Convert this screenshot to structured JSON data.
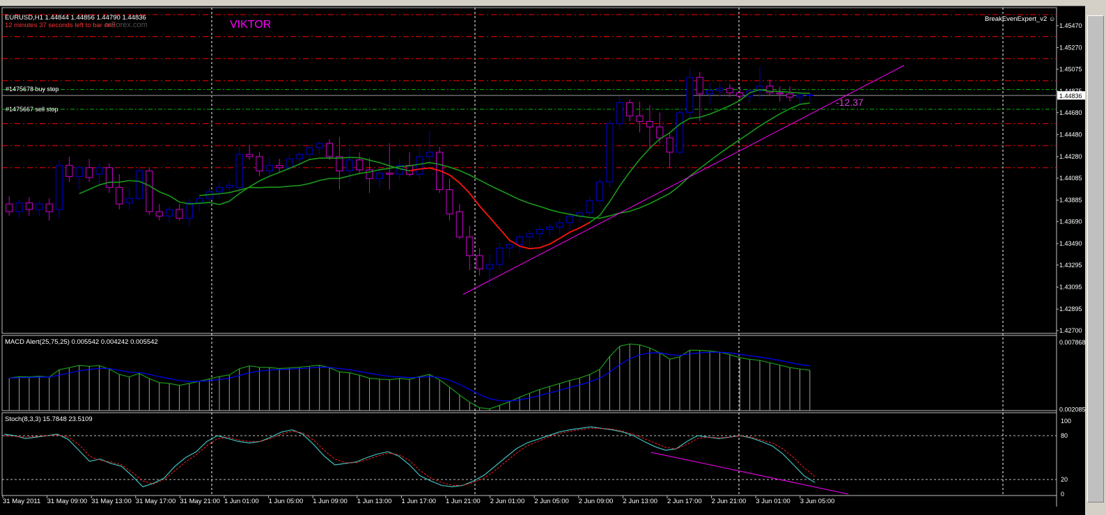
{
  "window": {
    "symbol_line": "EURUSD,H1  1.44844 1.44856 1.44790 1.44836",
    "countdown": "12 minutes 37 seconds left to bar end",
    "watermark": "orForex.com",
    "author": "VIKTOR",
    "expert": "BreakEvenExpert_v2",
    "order_buy": "#1475678 buy stop",
    "order_sell": "#1475667 sell stop",
    "pips_label": "-12.37",
    "current_price": "1.44836"
  },
  "colors": {
    "background": "#000000",
    "grid": "#c0c0c0",
    "bull": "#0000cc",
    "bear": "#cc00cc",
    "ma_fast": "#1b9a1b",
    "ma_turn": "#ff1010",
    "level": "#ff0000",
    "order_level": "#00c000",
    "trendline": "#ff00ff",
    "macd_signal": "#0000ff",
    "stoch_main": "#40c0c0",
    "stoch_signal": "#ff2020"
  },
  "chart_data": [
    {
      "type": "candlestick",
      "title": "EURUSD,H1",
      "x_labels": [
        "31 May 2011",
        "31 May 09:00",
        "31 May 13:00",
        "31 May 17:00",
        "31 May 21:00",
        "1 Jun 01:00",
        "1 Jun 05:00",
        "1 Jun 09:00",
        "1 Jun 13:00",
        "1 Jun 17:00",
        "1 Jun 21:00",
        "2 Jun 01:00",
        "2 Jun 05:00",
        "2 Jun 09:00",
        "2 Jun 13:00",
        "2 Jun 17:00",
        "2 Jun 21:00",
        "3 Jun 01:00",
        "3 Jun 05:00"
      ],
      "y_ticks": [
        "1.45470",
        "1.45270",
        "1.45075",
        "1.44875",
        "1.44680",
        "1.44480",
        "1.44280",
        "1.44085",
        "1.43885",
        "1.43690",
        "1.43490",
        "1.43295",
        "1.43095",
        "1.42895",
        "1.42700"
      ],
      "ylim": [
        1.427,
        1.4557
      ],
      "order_levels": [
        1.4489,
        1.4471
      ],
      "support_resistance": [
        1.4557,
        1.4537,
        1.4517,
        1.4497,
        1.4458,
        1.4438,
        1.4418
      ],
      "ohlc": [
        [
          1.4385,
          1.4392,
          1.4374,
          1.4378
        ],
        [
          1.4378,
          1.4389,
          1.4372,
          1.4386
        ],
        [
          1.4386,
          1.4391,
          1.4374,
          1.438
        ],
        [
          1.438,
          1.4388,
          1.4374,
          1.4385
        ],
        [
          1.4385,
          1.439,
          1.437,
          1.4378
        ],
        [
          1.438,
          1.4425,
          1.4372,
          1.442
        ],
        [
          1.442,
          1.4428,
          1.4405,
          1.441
        ],
        [
          1.441,
          1.442,
          1.4398,
          1.4418
        ],
        [
          1.4418,
          1.4426,
          1.4405,
          1.4409
        ],
        [
          1.4412,
          1.4422,
          1.4402,
          1.4418
        ],
        [
          1.4418,
          1.4422,
          1.4395,
          1.44
        ],
        [
          1.44,
          1.4412,
          1.438,
          1.4385
        ],
        [
          1.4386,
          1.44,
          1.438,
          1.439
        ],
        [
          1.439,
          1.4418,
          1.4388,
          1.4415
        ],
        [
          1.4415,
          1.4418,
          1.4375,
          1.4378
        ],
        [
          1.4378,
          1.4385,
          1.437,
          1.4374
        ],
        [
          1.4374,
          1.4383,
          1.4368,
          1.438
        ],
        [
          1.438,
          1.4385,
          1.437,
          1.4372
        ],
        [
          1.4372,
          1.439,
          1.4365,
          1.4386
        ],
        [
          1.4386,
          1.4392,
          1.4378,
          1.439
        ],
        [
          1.439,
          1.44,
          1.4384,
          1.4396
        ],
        [
          1.4396,
          1.4405,
          1.439,
          1.44
        ],
        [
          1.44,
          1.4406,
          1.4392,
          1.4402
        ],
        [
          1.44,
          1.4436,
          1.4395,
          1.443
        ],
        [
          1.443,
          1.4438,
          1.4425,
          1.4428
        ],
        [
          1.4428,
          1.4432,
          1.441,
          1.4415
        ],
        [
          1.4415,
          1.4428,
          1.441,
          1.442
        ],
        [
          1.442,
          1.4426,
          1.4414,
          1.4418
        ],
        [
          1.4418,
          1.443,
          1.4415,
          1.4426
        ],
        [
          1.4426,
          1.4432,
          1.442,
          1.443
        ],
        [
          1.443,
          1.444,
          1.4426,
          1.4436
        ],
        [
          1.4436,
          1.4442,
          1.443,
          1.444
        ],
        [
          1.444,
          1.4444,
          1.4425,
          1.4428
        ],
        [
          1.4428,
          1.4446,
          1.4398,
          1.4415
        ],
        [
          1.4415,
          1.4436,
          1.4405,
          1.4425
        ],
        [
          1.4425,
          1.4432,
          1.4412,
          1.4416
        ],
        [
          1.4416,
          1.4427,
          1.4395,
          1.4408
        ],
        [
          1.4408,
          1.442,
          1.44,
          1.4413
        ],
        [
          1.4413,
          1.444,
          1.4398,
          1.4412
        ],
        [
          1.4412,
          1.4426,
          1.4406,
          1.442
        ],
        [
          1.442,
          1.4432,
          1.441,
          1.4412
        ],
        [
          1.4412,
          1.444,
          1.4407,
          1.4428
        ],
        [
          1.4428,
          1.4452,
          1.442,
          1.4432
        ],
        [
          1.4432,
          1.4437,
          1.4395,
          1.4398
        ],
        [
          1.4398,
          1.4408,
          1.437,
          1.4376
        ],
        [
          1.4378,
          1.4385,
          1.4353,
          1.4355
        ],
        [
          1.4355,
          1.4365,
          1.4325,
          1.4338
        ],
        [
          1.4338,
          1.4345,
          1.432,
          1.4326
        ],
        [
          1.4326,
          1.434,
          1.431,
          1.433
        ],
        [
          1.433,
          1.435,
          1.4325,
          1.4345
        ],
        [
          1.4345,
          1.4352,
          1.4336,
          1.4348
        ],
        [
          1.4348,
          1.4358,
          1.434,
          1.4355
        ],
        [
          1.4355,
          1.4362,
          1.4346,
          1.4358
        ],
        [
          1.4358,
          1.4366,
          1.435,
          1.4362
        ],
        [
          1.4362,
          1.4367,
          1.4355,
          1.4364
        ],
        [
          1.4364,
          1.4372,
          1.4357,
          1.4368
        ],
        [
          1.4368,
          1.4378,
          1.4362,
          1.4374
        ],
        [
          1.4374,
          1.438,
          1.4368,
          1.4377
        ],
        [
          1.4377,
          1.4392,
          1.4372,
          1.4388
        ],
        [
          1.4388,
          1.4408,
          1.4384,
          1.4405
        ],
        [
          1.4405,
          1.4462,
          1.44,
          1.4458
        ],
        [
          1.4458,
          1.4483,
          1.4452,
          1.4477
        ],
        [
          1.4477,
          1.448,
          1.446,
          1.4465
        ],
        [
          1.4465,
          1.4478,
          1.445,
          1.446
        ],
        [
          1.446,
          1.4475,
          1.4435,
          1.4455
        ],
        [
          1.4455,
          1.4468,
          1.444,
          1.4445
        ],
        [
          1.4445,
          1.445,
          1.4418,
          1.4432
        ],
        [
          1.4432,
          1.4472,
          1.443,
          1.4468
        ],
        [
          1.4468,
          1.4508,
          1.4462,
          1.45
        ],
        [
          1.45,
          1.4505,
          1.446,
          1.4485
        ],
        [
          1.4485,
          1.4495,
          1.4475,
          1.4488
        ],
        [
          1.4488,
          1.4496,
          1.4482,
          1.449
        ],
        [
          1.449,
          1.4494,
          1.4482,
          1.4486
        ],
        [
          1.4486,
          1.4492,
          1.448,
          1.4483
        ],
        [
          1.4483,
          1.449,
          1.4477,
          1.4488
        ],
        [
          1.4488,
          1.451,
          1.448,
          1.4492
        ],
        [
          1.4492,
          1.4498,
          1.4484,
          1.4486
        ],
        [
          1.4486,
          1.4492,
          1.4478,
          1.4485
        ],
        [
          1.4485,
          1.4492,
          1.4478,
          1.4482
        ],
        [
          1.4482,
          1.4487,
          1.4476,
          1.4484
        ],
        [
          1.4484,
          1.4486,
          1.4478,
          1.4484
        ]
      ]
    },
    {
      "type": "bar",
      "title": "MACD Alert(25,75,25) 0.005542 0.004242 0.005542",
      "y_ticks": [
        "0.007868",
        "0.002085"
      ],
      "ylim": [
        0.002,
        0.008
      ]
    },
    {
      "type": "line",
      "title": "Stoch(8,3,3) 15.7848 23.5109",
      "y_ticks": [
        "100",
        "80",
        "20",
        "0"
      ],
      "ylim": [
        0,
        100
      ],
      "levels": [
        80,
        20
      ],
      "main": [
        82,
        80,
        76,
        78,
        80,
        82,
        75,
        60,
        45,
        48,
        42,
        38,
        25,
        10,
        15,
        22,
        38,
        50,
        58,
        72,
        80,
        76,
        72,
        70,
        72,
        78,
        85,
        88,
        82,
        68,
        52,
        40,
        42,
        44,
        50,
        55,
        58,
        52,
        40,
        25,
        18,
        12,
        10,
        12,
        18,
        26,
        38,
        50,
        62,
        70,
        75,
        80,
        85,
        88,
        90,
        92,
        90,
        88,
        85,
        80,
        72,
        65,
        60,
        62,
        72,
        80,
        78,
        76,
        78,
        80,
        77,
        72,
        66,
        55,
        40,
        25,
        16
      ],
      "signal": [
        80,
        79,
        78,
        79,
        80,
        81,
        78,
        68,
        52,
        46,
        44,
        40,
        30,
        18,
        14,
        20,
        32,
        44,
        54,
        66,
        76,
        78,
        74,
        72,
        72,
        76,
        82,
        86,
        84,
        74,
        60,
        48,
        43,
        43,
        47,
        52,
        56,
        54,
        46,
        32,
        22,
        16,
        12,
        12,
        16,
        22,
        32,
        44,
        56,
        66,
        72,
        78,
        83,
        86,
        88,
        90,
        90,
        89,
        86,
        82,
        76,
        70,
        64,
        62,
        68,
        76,
        78,
        77,
        78,
        80,
        78,
        74,
        70,
        62,
        50,
        36,
        24
      ]
    }
  ]
}
